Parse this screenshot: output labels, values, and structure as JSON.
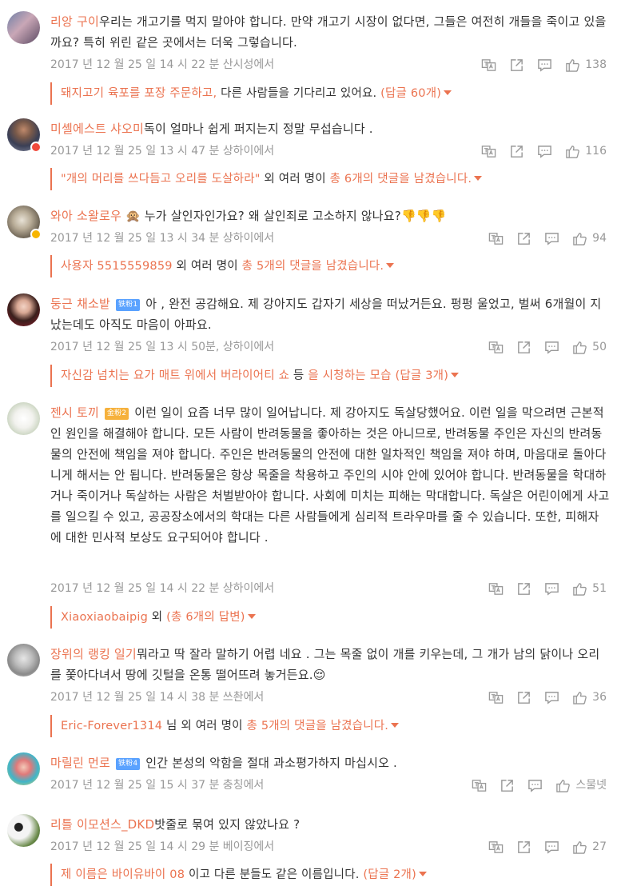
{
  "comments": [
    {
      "user": "리앙 구이",
      "text": "우리는 개고기를 먹지 말아야 합니다. 만약 개고기 시장이 없다면, 그들은 여전히 개들을 죽이고 있을까요? 특히 위린 같은 곳에서는 더욱 그렇습니다.",
      "meta": "2017 년 12 월 25 일 14 시 22 분 산시성에서",
      "likes": "138",
      "reply_text": "돼지고기 육포를 포장 주문하고,",
      "reply_tail": " 다른 사람들을 기다리고 있어요. ",
      "reply_count": "(답글 60개)"
    },
    {
      "user": "미셸에스트 샤오미",
      "text": "독이 얼마나 쉽게 퍼지는지 정말 무섭습니다 .",
      "meta": "2017 년 12 월 25 일 13 시 47 분 상하이에서",
      "likes": "116",
      "reply_text": "\"개의 머리를 쓰다듬고 오리를 도살하라\"",
      "reply_tail": " 외 여러 명이 ",
      "reply_count": "총 6개의 댓글을 남겼습니다."
    },
    {
      "user": "와아 소왈로우",
      "emoji_pre": "🙊",
      "text": " 누가 살인자인가요? 왜 살인죄로 고소하지 않나요?",
      "emoji_post": "👎👎👎",
      "meta": "2017 년 12 월 25 일 13 시 34 분 상하이에서",
      "likes": "94",
      "reply_text": "사용자 5515559859",
      "reply_tail": " 외 여러 명이 ",
      "reply_count": "총 5개의 댓글을 남겼습니다."
    },
    {
      "user": "둥근 채소밭",
      "tag": "铁粉1",
      "text": " 아 , 완전 공감해요. 제 강아지도 갑자기 세상을 떠났거든요. 펑펑 울었고, 벌써 6개월이 지났는데도 아직도 마음이 아파요.",
      "meta": "2017 년 12 월 25 일 13 시 50분, 상하이에서",
      "likes": "50",
      "reply_text": "자신감 넘치는 요가 매트 위에서 버라이어티 쇼",
      "reply_tail": " 등 ",
      "reply_count": "을 시청하는 모습 (답글 3개)"
    },
    {
      "user": "젠시 토끼",
      "tag": "金粉2",
      "text": " 이런 일이 요즘 너무 많이 일어납니다. 제 강아지도 독살당했어요. 이런 일을 막으려면 근본적인 원인을 해결해야 합니다. 모든 사람이 반려동물을 좋아하는 것은 아니므로, 반려동물 주인은 자신의 반려동물의 안전에 책임을 져야 합니다. 주인은 반려동물의 안전에 대한 일차적인 책임을 져야 하며, 마음대로 돌아다니게 해서는 안 됩니다. 반려동물은 항상 목줄을 착용하고 주인의 시야 안에 있어야 합니다. 반려동물을 학대하거나 죽이거나 독살하는 사람은 처벌받아야 합니다. 사회에 미치는 피해는 막대합니다. 독살은 어린이에게 사고를 일으킬 수 있고, 공공장소에서의 학대는 다른 사람들에게 심리적 트라우마를 줄 수 있습니다. 또한, 피해자에 대한 민사적 보상도 요구되어야 합니다 .",
      "meta": "2017 년 12 월 25 일 14 시 22 분 상하이에서",
      "likes": "51",
      "reply_text": "Xiaoxiaobaipig",
      "reply_tail": " 외 ",
      "reply_count": "(총 6개의 답변)"
    },
    {
      "user": "장위의 랭킹 일기",
      "text": "뭐라고 딱 잘라 말하기 어렵 네요 . 그는 목줄 없이 개를 키우는데, 그 개가 남의 닭이나 오리를 쫓아다녀서 땅에 깃털을 온통 떨어뜨려 놓거든요.",
      "emoji_post": "😌",
      "meta": "2017 년 12 월 25 일 14 시 38 분 쓰촨에서",
      "likes": "36",
      "reply_text": "Eric-Forever1314",
      "reply_tail": " 님 외 여러 명이 ",
      "reply_count": "총 5개의 댓글을 남겼습니다."
    },
    {
      "user": "마릴린 먼로",
      "tag": "铁粉4",
      "text": " 인간 본성의 악함을 절대 과소평가하지 마십시오 .",
      "meta": "2017 년 12 월 25 일 15 시 37 분 충칭에서",
      "likes": "스물넷"
    },
    {
      "user": "리틀 이모션스_DKD",
      "text": "밧줄로 묶여 있지 않았나요 ?",
      "meta": "2017 년 12 월 25 일 14 시 29 분 베이징에서",
      "likes": "27",
      "reply_text": "제 이름은 바이유바이 08",
      "reply_tail": " 이고 다른 분들도 같은 이름입니다. ",
      "reply_count": "(답글 2개)"
    }
  ],
  "icons": [
    "translate-icon",
    "share-icon",
    "comment-icon",
    "like-icon"
  ],
  "colors": {
    "accent": "#eb7350",
    "meta": "#999999",
    "text": "#333333"
  }
}
